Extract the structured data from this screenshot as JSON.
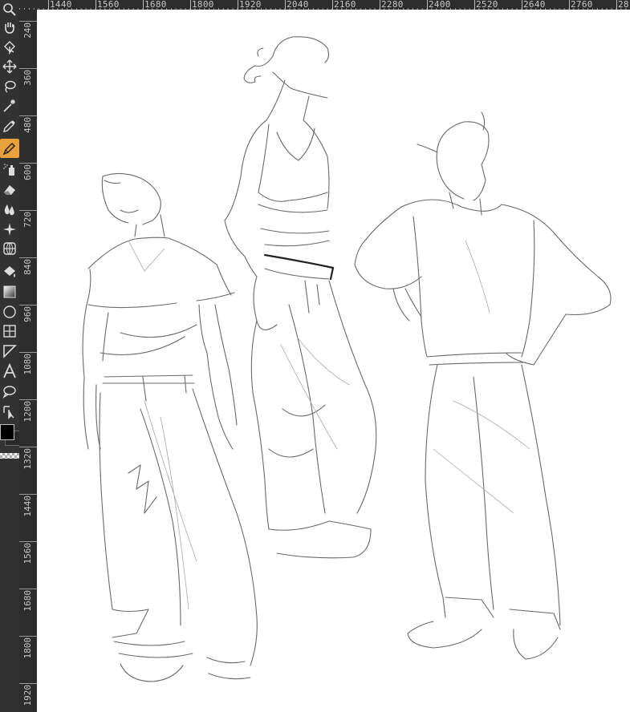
{
  "rulers": {
    "horizontal": [
      "1440",
      "1560",
      "1680",
      "1800",
      "1920",
      "2040",
      "2160",
      "2280",
      "2400",
      "2520",
      "2640",
      "2760",
      "28"
    ],
    "vertical": [
      "240",
      "360",
      "480",
      "600",
      "720",
      "840",
      "960",
      "1080",
      "1200",
      "1320",
      "1440",
      "1560",
      "1680",
      "1800",
      "1920"
    ]
  },
  "toolbox": {
    "active_tool": "freehand-brush-tool",
    "foreground_color": "#000000",
    "accent_color": "#e8a23a",
    "tools": [
      "zoom-tool",
      "pan-tool",
      "select-shapes-tool",
      "move-tool",
      "lasso-tool",
      "magic-wand-tool",
      "color-picker-tool",
      "freehand-brush-tool",
      "airbrush-tool",
      "eraser-tool",
      "smudge-tool",
      "sparkle-tool",
      "transform-tool",
      "fill-tool",
      "gradient-tool",
      "ellipse-tool",
      "grid-tool",
      "polygon-tool",
      "text-tool",
      "freehand-selection-tool",
      "path-edit-tool"
    ]
  }
}
